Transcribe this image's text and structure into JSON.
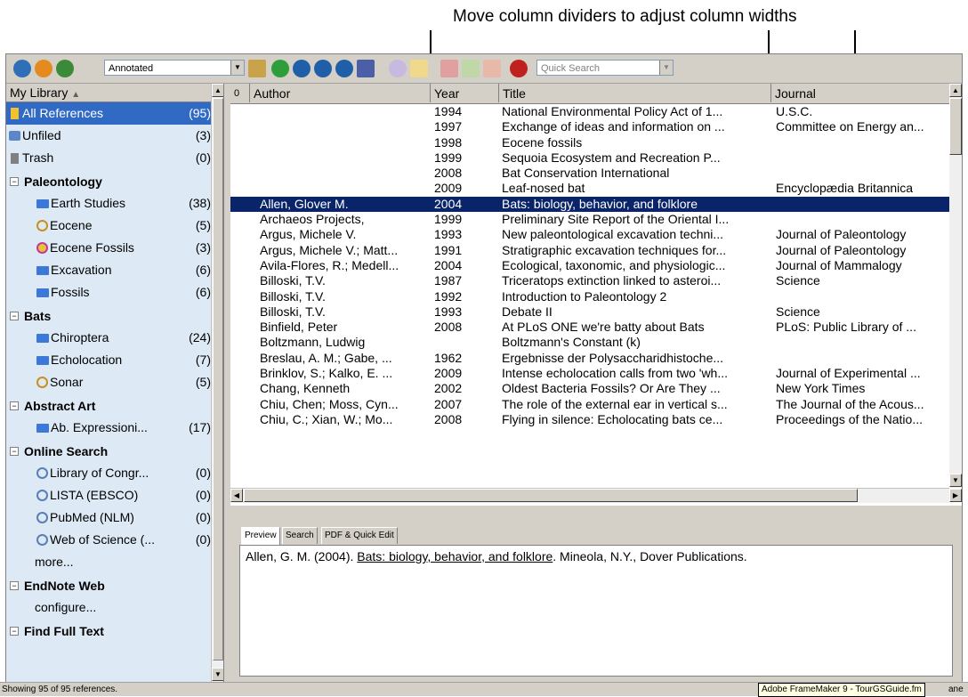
{
  "callout": "Move column dividers to adjust column widths",
  "toolbar": {
    "style_value": "Annotated",
    "quick_search_placeholder": "Quick Search"
  },
  "sidebar": {
    "header": "My Library",
    "top_items": [
      {
        "label": "All References",
        "count": "(95)"
      },
      {
        "label": "Unfiled",
        "count": "(3)"
      },
      {
        "label": "Trash",
        "count": "(0)"
      }
    ],
    "groups": [
      {
        "name": "Paleontology",
        "items": [
          {
            "label": "Earth Studies",
            "count": "(38)"
          },
          {
            "label": "Eocene",
            "count": "(5)"
          },
          {
            "label": "Eocene Fossils",
            "count": "(3)"
          },
          {
            "label": "Excavation",
            "count": "(6)"
          },
          {
            "label": "Fossils",
            "count": "(6)"
          }
        ]
      },
      {
        "name": "Bats",
        "items": [
          {
            "label": "Chiroptera",
            "count": "(24)"
          },
          {
            "label": "Echolocation",
            "count": "(7)"
          },
          {
            "label": "Sonar",
            "count": "(5)"
          }
        ]
      },
      {
        "name": "Abstract Art",
        "items": [
          {
            "label": "Ab. Expressioni...",
            "count": "(17)"
          }
        ]
      },
      {
        "name": "Online Search",
        "items": [
          {
            "label": "Library of Congr...",
            "count": "(0)"
          },
          {
            "label": "LISTA (EBSCO)",
            "count": "(0)"
          },
          {
            "label": "PubMed (NLM)",
            "count": "(0)"
          },
          {
            "label": "Web of Science (...",
            "count": "(0)"
          },
          {
            "label": "more...",
            "count": ""
          }
        ]
      },
      {
        "name": "EndNote Web",
        "items": [
          {
            "label": "configure...",
            "count": ""
          }
        ]
      },
      {
        "name": "Find Full Text",
        "items": []
      }
    ]
  },
  "table": {
    "headers": {
      "attach": "0",
      "author": "Author",
      "year": "Year",
      "title": "Title",
      "journal": "Journal"
    },
    "rows": [
      {
        "author": "",
        "year": "1994",
        "title": "National Environmental Policy Act of 1...",
        "journal": "U.S.C."
      },
      {
        "author": "",
        "year": "1997",
        "title": "Exchange of ideas and information on ...",
        "journal": "Committee on Energy an..."
      },
      {
        "author": "",
        "year": "1998",
        "title": "Eocene fossils",
        "journal": ""
      },
      {
        "author": "",
        "year": "1999",
        "title": "Sequoia Ecosystem and Recreation P...",
        "journal": ""
      },
      {
        "author": "",
        "year": "2008",
        "title": "Bat Conservation International",
        "journal": ""
      },
      {
        "author": "",
        "year": "2009",
        "title": "Leaf-nosed bat",
        "journal": "Encyclopædia Britannica"
      },
      {
        "author": "Allen, Glover M.",
        "year": "2004",
        "title": "Bats: biology, behavior, and folklore",
        "journal": ""
      },
      {
        "author": "Archaeos Projects,",
        "year": "1999",
        "title": "Preliminary Site Report of the Oriental I...",
        "journal": ""
      },
      {
        "author": "Argus, Michele V.",
        "year": "1993",
        "title": "New paleontological excavation techni...",
        "journal": "Journal of Paleontology"
      },
      {
        "author": "Argus, Michele V.; Matt...",
        "year": "1991",
        "title": "Stratigraphic excavation techniques for...",
        "journal": "Journal of Paleontology"
      },
      {
        "author": "Avila-Flores, R.; Medell...",
        "year": "2004",
        "title": "Ecological, taxonomic, and physiologic...",
        "journal": "Journal of Mammalogy"
      },
      {
        "author": "Billoski, T.V.",
        "year": "1987",
        "title": "Triceratops extinction linked to asteroi...",
        "journal": "Science"
      },
      {
        "author": "Billoski, T.V.",
        "year": "1992",
        "title": "Introduction to Paleontology 2",
        "journal": ""
      },
      {
        "author": "Billoski, T.V.",
        "year": "1993",
        "title": "Debate II",
        "journal": "Science"
      },
      {
        "author": "Binfield, Peter",
        "year": "2008",
        "title": "At PLoS ONE we're batty about Bats",
        "journal": "PLoS: Public Library of ..."
      },
      {
        "author": "Boltzmann, Ludwig",
        "year": "",
        "title": "Boltzmann's Constant (k)",
        "journal": ""
      },
      {
        "author": "Breslau, A. M.; Gabe, ...",
        "year": "1962",
        "title": "Ergebnisse der Polysaccharidhistoche...",
        "journal": ""
      },
      {
        "author": "Brinklov, S.; Kalko, E. ...",
        "year": "2009",
        "title": "Intense echolocation calls from two 'wh...",
        "journal": "Journal of Experimental ..."
      },
      {
        "author": "Chang, Kenneth",
        "year": "2002",
        "title": "Oldest Bacteria Fossils? Or Are They ...",
        "journal": "New York Times"
      },
      {
        "author": "Chiu, Chen; Moss, Cyn...",
        "year": "2007",
        "title": "The role of the external ear in vertical s...",
        "journal": "The Journal of the Acous..."
      },
      {
        "author": "Chiu, C.; Xian, W.; Mo...",
        "year": "2008",
        "title": "Flying in silence: Echolocating bats ce...",
        "journal": "Proceedings of the Natio..."
      }
    ]
  },
  "preview": {
    "tabs": [
      "Preview",
      "Search",
      "PDF & Quick Edit"
    ],
    "citation_prefix": "Allen, G. M. (2004). ",
    "citation_title": "Bats: biology, behavior, and folklore",
    "citation_suffix": ". Mineola, N.Y., Dover Publications."
  },
  "status": {
    "text": "Showing 95 of 95 references.",
    "tooltip": "Adobe FrameMaker 9 - TourGSGuide.fm",
    "pane_fragment": "ane"
  }
}
